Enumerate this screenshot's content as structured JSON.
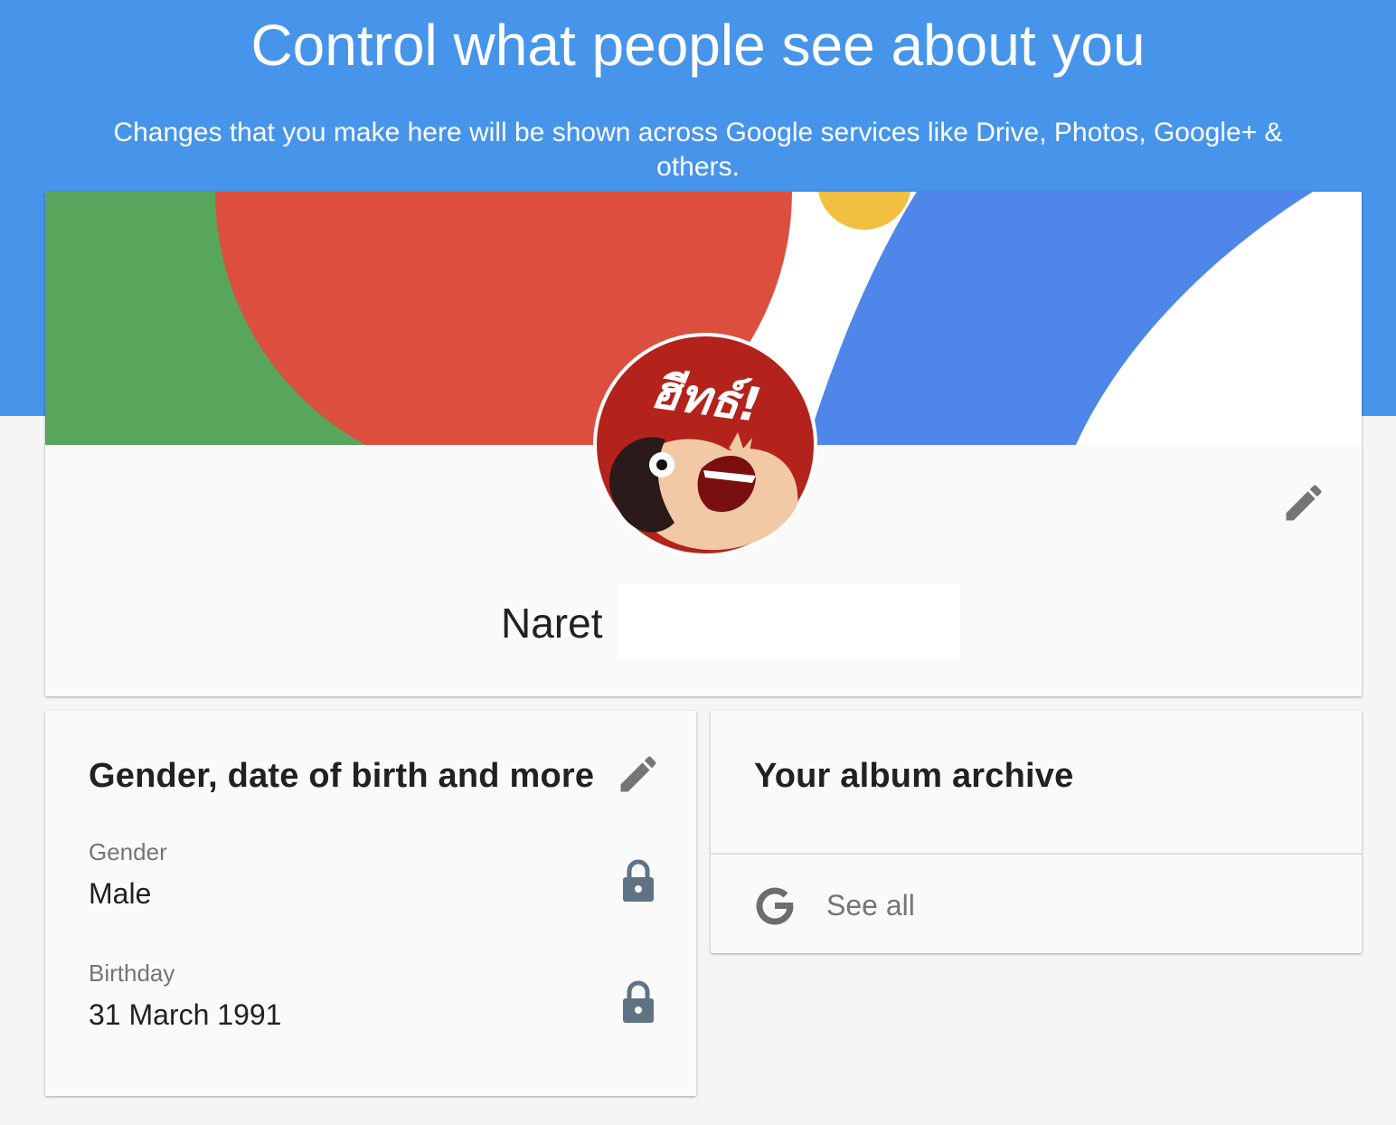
{
  "header": {
    "title": "Control what people see about you",
    "subtitle": "Changes that you make here will be shown across Google services like Drive, Photos, Google+ & others."
  },
  "profile": {
    "name": "Naret",
    "avatar_text": "ฮีทธ์!",
    "edit_icon": "pencil-icon"
  },
  "about": {
    "title": "Gender, date of birth and more",
    "edit_icon": "pencil-icon",
    "fields": [
      {
        "label": "Gender",
        "value": "Male",
        "icon": "lock-icon"
      },
      {
        "label": "Birthday",
        "value": "31 March 1991",
        "icon": "lock-icon"
      }
    ]
  },
  "album": {
    "title": "Your album archive",
    "see_all_label": "See all",
    "see_all_icon": "google-g-icon"
  },
  "colors": {
    "header_blue": "#4795ea",
    "cover_green": "#58a65c",
    "cover_red": "#dc4f3f",
    "cover_yellow": "#f2bf41",
    "cover_blue": "#4f86e9",
    "avatar_red": "#b3231c",
    "icon_gray": "#757575",
    "lock_gray": "#5f7385"
  }
}
